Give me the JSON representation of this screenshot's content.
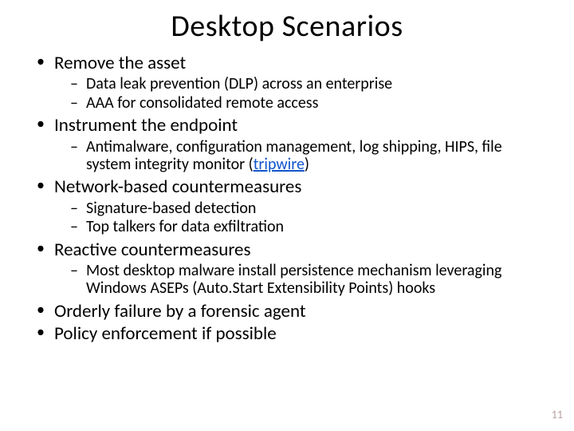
{
  "title": "Desktop Scenarios",
  "bullets": [
    {
      "text": "Remove the asset",
      "sub": [
        "Data leak prevention (DLP) across an enterprise",
        "AAA for consolidated remote access"
      ]
    },
    {
      "text": "Instrument the endpoint",
      "sub": [
        {
          "prefix": "Antimalware, configuration management, log shipping, HIPS, file system integrity monitor (",
          "link": "tripwire",
          "suffix": ")"
        }
      ]
    },
    {
      "text": "Network-based countermeasures",
      "sub": [
        "Signature-based detection",
        "Top talkers for data exfiltration"
      ]
    },
    {
      "text": "Reactive countermeasures",
      "sub": [
        "Most desktop malware install persistence mechanism leveraging Windows ASEPs (Auto.Start Extensibility Points) hooks"
      ]
    },
    {
      "text": "Orderly failure by a forensic agent",
      "sub": []
    },
    {
      "text": "Policy enforcement if possible",
      "sub": []
    }
  ],
  "page_number": "11"
}
